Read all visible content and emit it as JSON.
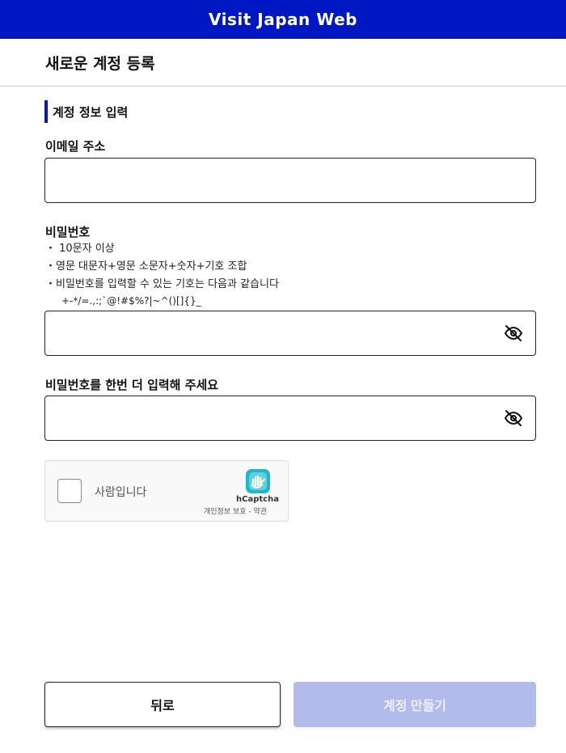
{
  "header": {
    "title": "Visit Japan Web"
  },
  "page": {
    "title": "새로운 계정 등록"
  },
  "section": {
    "title": "계정 정보 입력"
  },
  "email": {
    "label": "이메일 주소",
    "value": "",
    "placeholder": ""
  },
  "password": {
    "label": "비밀번호",
    "value": "",
    "rules": [
      "・ 10문자 이상",
      "・영문 대문자+영문 소문자+숫자+기호 조합",
      "・비밀번호를 입력할 수 있는 기호는 다음과 같습니다"
    ],
    "symbols": "+-*/=.,:;`@!#$%?|~^()[]{}_"
  },
  "password_confirm": {
    "label": "비밀번호를 한번 더 입력해 주세요",
    "value": ""
  },
  "captcha": {
    "label": "사람입니다",
    "brand": "hCaptcha",
    "links": "개인정보 보호 - 약관",
    "checked": false
  },
  "buttons": {
    "back": "뒤로",
    "create": "계정 만들기"
  },
  "colors": {
    "brand": "#0018c4",
    "disabled_button": "#b3baec"
  },
  "icons": {
    "password_toggle": "eye-slash-icon",
    "captcha_logo": "hcaptcha-logo-icon"
  }
}
